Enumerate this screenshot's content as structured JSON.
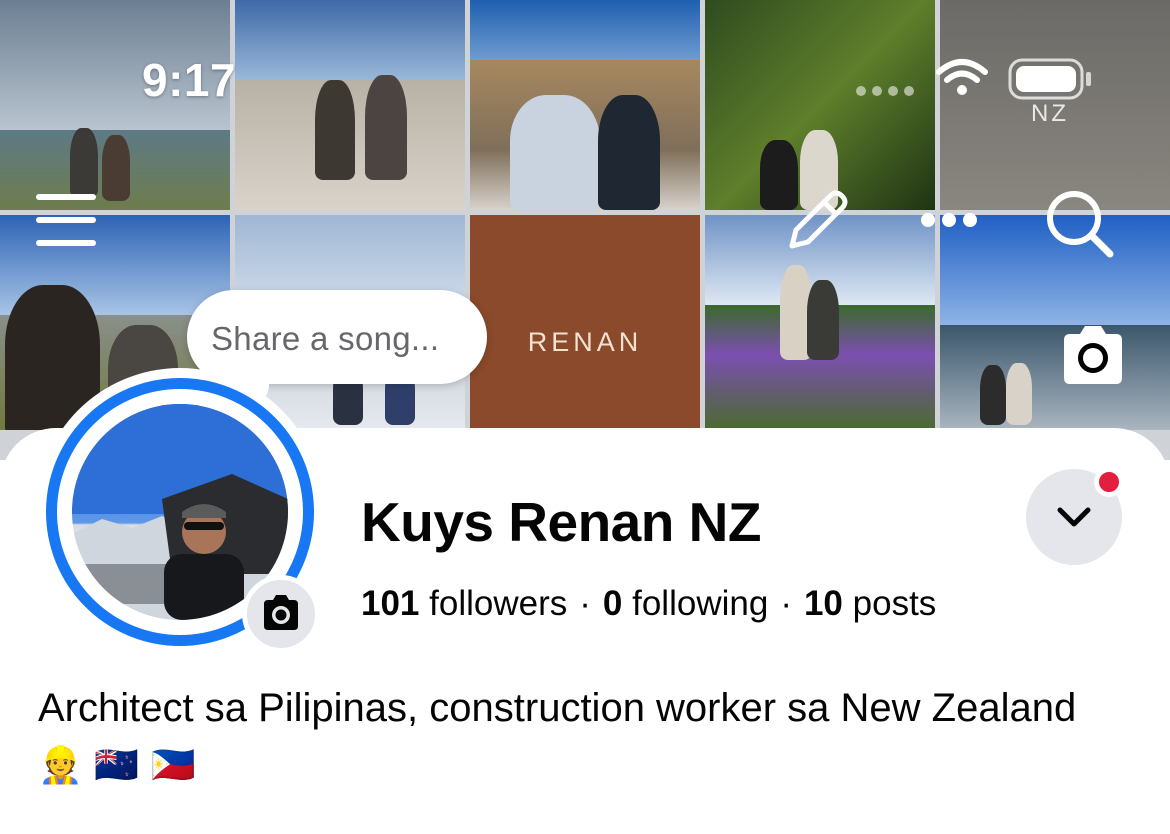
{
  "status_bar": {
    "time": "9:17",
    "wifi_icon": "wifi-icon",
    "battery_icon": "battery-icon",
    "carrier_label": "NZ"
  },
  "top_actions": {
    "menu_icon": "hamburger-menu-icon",
    "edit_icon": "pencil-icon",
    "more_icon": "more-horizontal-icon",
    "search_icon": "search-icon",
    "cover_camera_icon": "camera-icon"
  },
  "cover": {
    "tile_text": "RENAN"
  },
  "share_song": {
    "placeholder": "Share a song..."
  },
  "profile": {
    "name": "Kuys Renan NZ",
    "followers_count": "101",
    "followers_label": "followers",
    "following_count": "0",
    "following_label": "following",
    "posts_count": "10",
    "posts_label": "posts",
    "separator": "·",
    "bio_text": "Architect sa Pilipinas, construction worker sa New Zealand",
    "bio_emojis": "👷 🇳🇿 🇵🇭"
  },
  "colors": {
    "story_ring": "#1877f2",
    "notification_dot": "#e41e3f",
    "button_bg": "#e4e6eb",
    "text_primary": "#050505",
    "text_secondary": "#65676b"
  }
}
